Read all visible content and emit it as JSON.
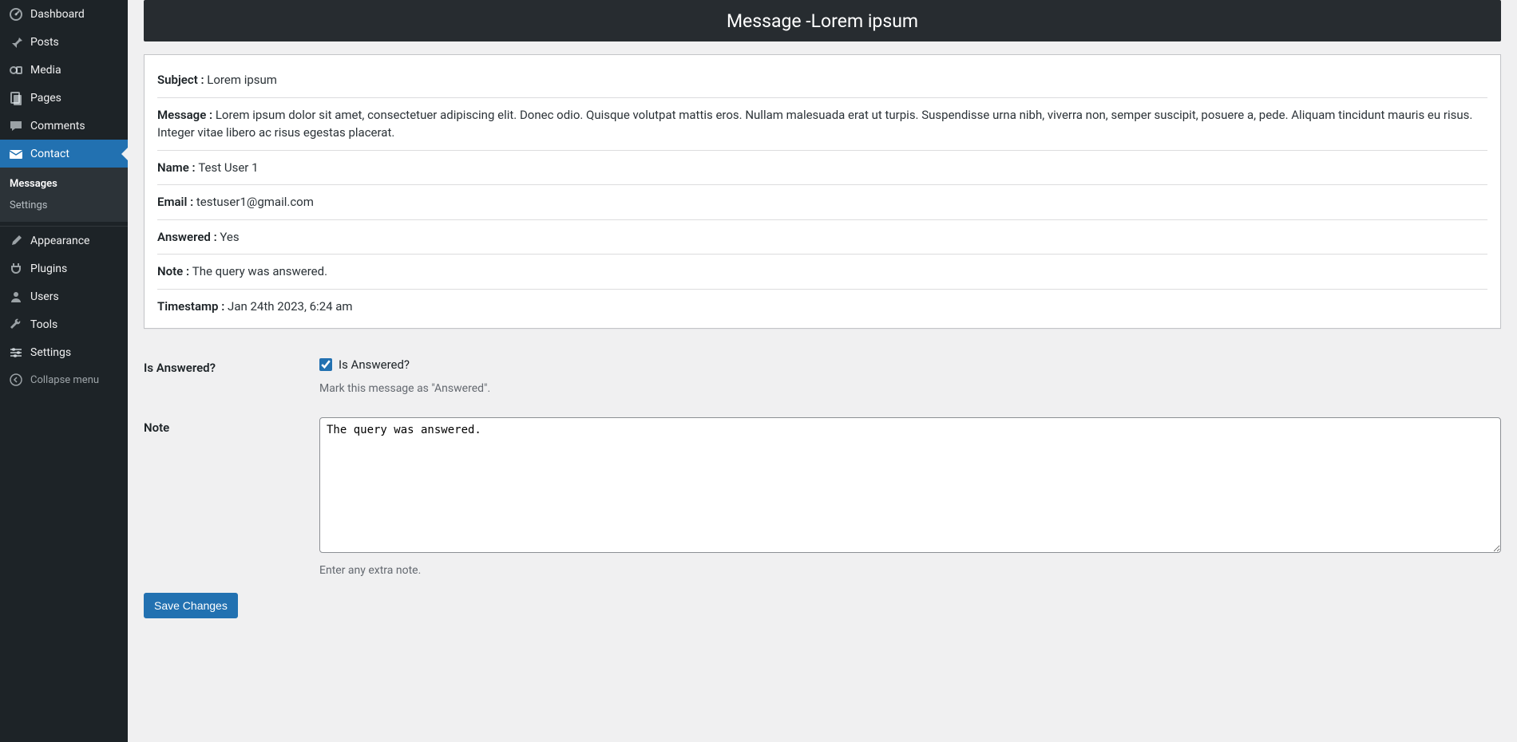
{
  "sidebar": {
    "items": [
      {
        "id": "dashboard",
        "label": "Dashboard"
      },
      {
        "id": "posts",
        "label": "Posts"
      },
      {
        "id": "media",
        "label": "Media"
      },
      {
        "id": "pages",
        "label": "Pages"
      },
      {
        "id": "comments",
        "label": "Comments"
      },
      {
        "id": "contact",
        "label": "Contact",
        "current": true,
        "submenu": [
          {
            "id": "messages",
            "label": "Messages",
            "current": true
          },
          {
            "id": "settings",
            "label": "Settings"
          }
        ]
      },
      {
        "id": "appearance",
        "label": "Appearance"
      },
      {
        "id": "plugins",
        "label": "Plugins"
      },
      {
        "id": "users",
        "label": "Users"
      },
      {
        "id": "tools",
        "label": "Tools"
      },
      {
        "id": "admin-settings",
        "label": "Settings"
      }
    ],
    "collapse_label": "Collapse menu"
  },
  "page": {
    "title_prefix": "Message - ",
    "title_subject": "Lorem ipsum"
  },
  "detail": {
    "subject_label": "Subject : ",
    "message_label": "Message : ",
    "name_label": "Name : ",
    "email_label": "Email : ",
    "answered_label": "Answered : ",
    "note_label": "Note : ",
    "timestamp_label": "Timestamp : ",
    "subject": "Lorem ipsum",
    "message": "Lorem ipsum dolor sit amet, consectetuer adipiscing elit. Donec odio. Quisque volutpat mattis eros. Nullam malesuada erat ut turpis. Suspendisse urna nibh, viverra non, semper suscipit, posuere a, pede. Aliquam tincidunt mauris eu risus. Integer vitae libero ac risus egestas placerat.",
    "name": "Test User 1",
    "email": "testuser1@gmail.com",
    "answered": "Yes",
    "note": "The query was answered.",
    "timestamp": "Jan 24th 2023, 6:24 am"
  },
  "form": {
    "is_answered_heading": "Is Answered?",
    "is_answered_checkbox_label": "Is Answered?",
    "is_answered_checked": true,
    "is_answered_help": "Mark this message as \"Answered\".",
    "note_heading": "Note",
    "note_value": "The query was answered.",
    "note_help": "Enter any extra note.",
    "submit_label": "Save Changes"
  }
}
